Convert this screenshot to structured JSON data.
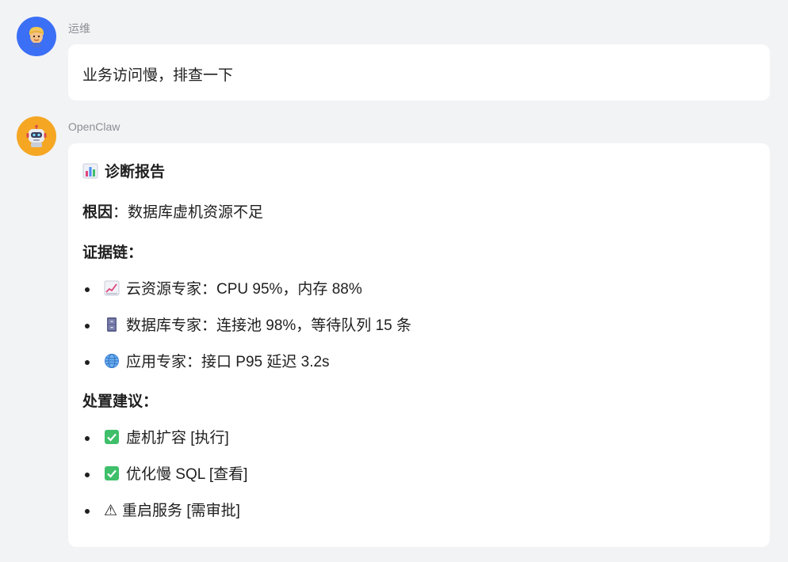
{
  "messages": [
    {
      "sender": "运维",
      "avatar_icon": "person-avatar-icon",
      "text": "业务访问慢，排查一下"
    },
    {
      "sender": "OpenClaw",
      "avatar_icon": "robot-avatar-icon",
      "report": {
        "title_icon": "bar-chart-icon",
        "title": "诊断报告",
        "root_cause_label": "根因",
        "root_cause_sep": "：",
        "root_cause_value": "数据库虚机资源不足",
        "evidence_label": "证据链：",
        "evidence": [
          {
            "icon": "chart-increasing-icon",
            "text": "云资源专家：CPU 95%，内存 88%"
          },
          {
            "icon": "file-cabinet-icon",
            "text": "数据库专家：连接池 98%，等待队列 15 条"
          },
          {
            "icon": "globe-icon",
            "text": "应用专家：接口 P95 延迟 3.2s"
          }
        ],
        "actions_label": "处置建议：",
        "actions": [
          {
            "icon": "check-mark-button-icon",
            "text": "虚机扩容 [执行]"
          },
          {
            "icon": "check-mark-button-icon",
            "text": "优化慢 SQL [查看]"
          },
          {
            "icon": "warning-icon",
            "glyph": "⚠",
            "text": "重启服务 [需审批]"
          }
        ]
      }
    }
  ],
  "colors": {
    "background": "#f2f3f5",
    "user_avatar": "#3b6ff5",
    "bot_avatar": "#f5a623",
    "check_green": "#3fbf6a"
  }
}
